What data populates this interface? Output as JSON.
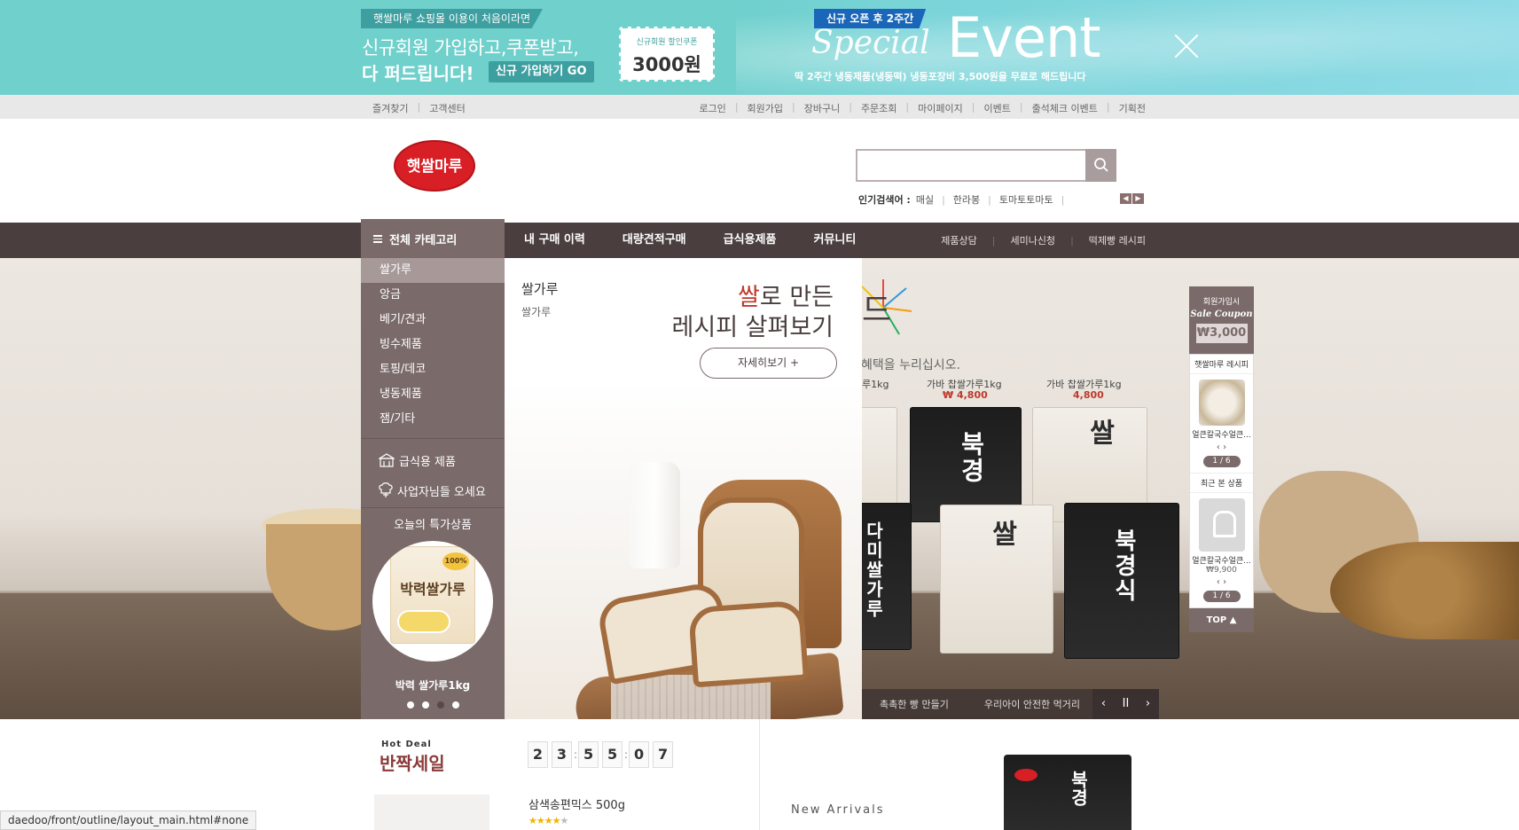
{
  "top_banner": {
    "tag": "햇쌀마루 쇼핑몰 이용이 처음이라면",
    "line1": "신규회원 가입하고,쿠폰받고,",
    "line2": "다 퍼드립니다!",
    "signup_button": "신규 가입하기 GO",
    "coupon_label": "신규회원 할인쿠폰",
    "coupon_amount": "3000원",
    "event_tag": "신규 오픈 후 2주간",
    "special": "Special",
    "event": "Event",
    "description": "딱 2주간 냉동제품(냉동떡) 냉동포장비 3,500원을 무료로 해드립니다"
  },
  "util_bar": {
    "left": [
      "즐겨찾기",
      "고객센터"
    ],
    "right": [
      "로그인",
      "회원가입",
      "장바구니",
      "주문조회",
      "마이페이지",
      "이벤트",
      "출석체크 이벤트",
      "기획전"
    ]
  },
  "header": {
    "logo_text": "햇쌀마루",
    "search_placeholder": "",
    "popular_label": "인기검색어 :",
    "popular_keywords": [
      "매실",
      "한라봉",
      "토마토토마토"
    ]
  },
  "gnb": {
    "all_category": "전체 카테고리",
    "main_items": [
      "내 구매 이력",
      "대량견적구매",
      "급식용제품",
      "커뮤니티"
    ],
    "sub_items": [
      "제품상담",
      "세미나신청",
      "떡제빵 레시피"
    ]
  },
  "category_menu": {
    "items": [
      "쌀가루",
      "앙금",
      "베기/견과",
      "빙수제품",
      "토핑/데코",
      "냉동제품",
      "잼/기타"
    ],
    "active_index": 0,
    "services": [
      "급식용 제품",
      "사업자님들 오세요"
    ],
    "special_title": "오늘의 특가상품",
    "special_product_pkg": "박력쌀가루",
    "special_product_badge": "100%",
    "special_product_name": "박력 쌀가루1kg",
    "dots": 4,
    "active_dot": 2
  },
  "category_panel": {
    "title": "쌀가루",
    "sub": "쌀가루",
    "promo_highlight": "쌀",
    "promo_line1": "로 만든",
    "promo_line2": "레시피 살펴보기",
    "more_button": "자세히보기 +"
  },
  "hero": {
    "heading_fragment": "드",
    "subtitle_fragment": "혜택을 누리십시오.",
    "products": [
      {
        "name": "루1kg",
        "price": ""
      },
      {
        "name": "가바 찹쌀가루1kg",
        "price": "₩ 4,800"
      },
      {
        "name": "가바 찹쌀가루1kg",
        "price": "4,800"
      }
    ],
    "package_texts": [
      "북경",
      "쌀",
      "다미쌀가루",
      "쌀",
      "북경식"
    ],
    "tabs": [
      "촉촉한 빵 만들기",
      "우리아이 안전한 먹거리"
    ],
    "controls": [
      "‹",
      "II",
      "›"
    ]
  },
  "quick": {
    "coupon_line1": "회원가입시",
    "coupon_line2": "Sale Coupon",
    "coupon_amount": "₩3,000",
    "recipe_title": "햇쌀마루 레시피",
    "recipe_name": "얼큰칼국수얼큰...",
    "recipe_arrows": "‹  ›",
    "recipe_pager": "1 / 6",
    "recent_title": "최근 본 상품",
    "recent_name": "얼큰칼국수얼큰...",
    "recent_price": "₩9,900",
    "recent_arrows": "‹  ›",
    "recent_pager": "1 / 6",
    "top_label": "TOP ▲"
  },
  "hot_deal": {
    "small": "Hot Deal",
    "title": "반짝세일",
    "timer": [
      "2",
      "3",
      "5",
      "5",
      "0",
      "7"
    ],
    "product_name": "삼색송편믹스 500g",
    "rating": 4
  },
  "new_arrivals": {
    "small": "New Arrivals",
    "product_text": "북경"
  },
  "status_url": "daedoo/front/outline/layout_main.html#none",
  "colors": {
    "brand_dark": "#4a3e3e",
    "brand_mid": "#7b6a6a",
    "banner_teal": "#6fd0cc",
    "price_red": "#c0392b"
  }
}
